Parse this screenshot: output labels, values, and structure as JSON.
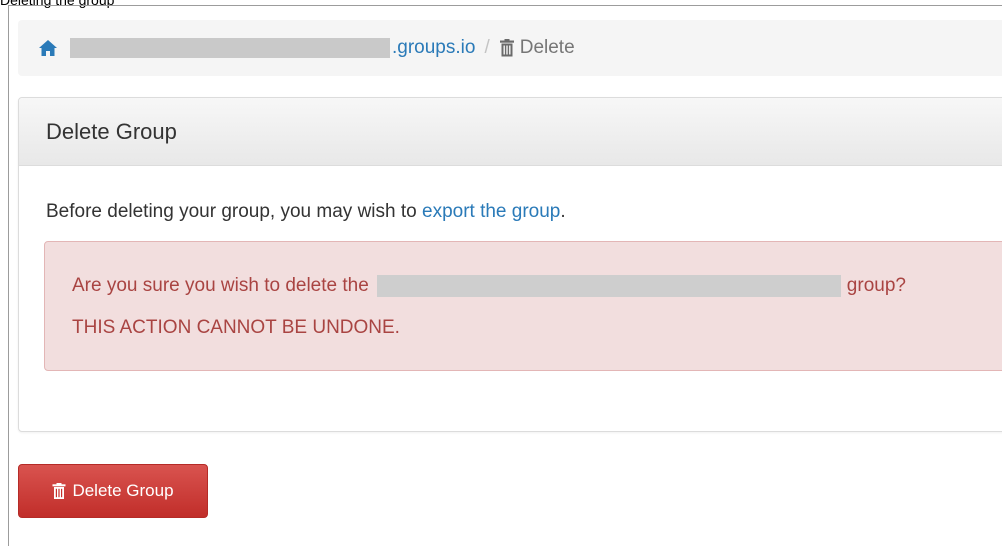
{
  "caption": "Deleting the group",
  "breadcrumb": {
    "domain_suffix": ".groups.io",
    "separator": "/",
    "current": "Delete",
    "home_icon": "home-icon",
    "trash_icon": "trash-icon"
  },
  "panel": {
    "title": "Delete Group",
    "intro_text": "Before deleting your group, you may wish to",
    "export_link": "export the group",
    "intro_end": "."
  },
  "alert": {
    "line1_prefix": "Are you sure you wish to delete the",
    "line1_suffix": "group?",
    "line2": "THIS ACTION CANNOT BE UNDONE."
  },
  "delete_button": {
    "label": "Delete Group",
    "icon": "trash-icon"
  },
  "colors": {
    "link": "#2a7ab8",
    "alert_bg": "#f2dede",
    "alert_text": "#a94442",
    "danger": "#d9534f"
  }
}
